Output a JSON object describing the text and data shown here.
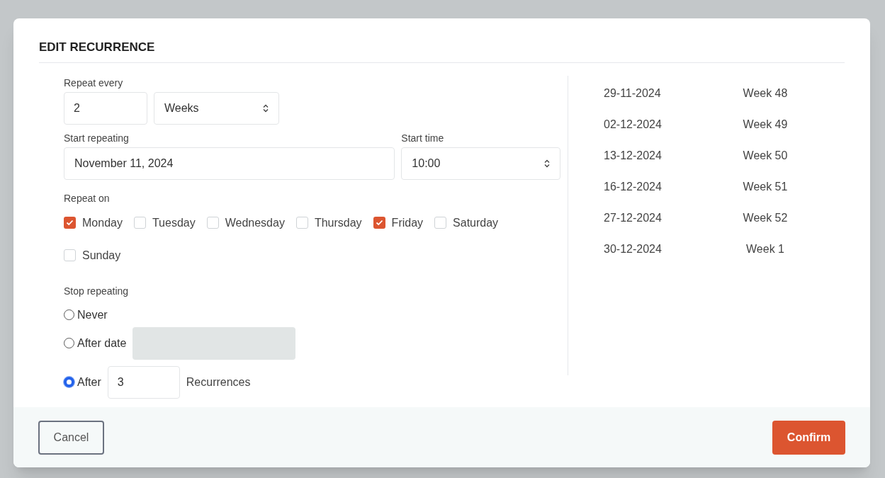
{
  "dialog": {
    "title": "EDIT RECURRENCE"
  },
  "repeat_every": {
    "label": "Repeat every",
    "value": "2",
    "unit": "Weeks"
  },
  "start_repeating": {
    "label": "Start repeating",
    "value": "November 11, 2024"
  },
  "start_time": {
    "label": "Start time",
    "value": "10:00"
  },
  "repeat_on": {
    "label": "Repeat on",
    "days": [
      {
        "label": "Monday",
        "checked": true
      },
      {
        "label": "Tuesday",
        "checked": false
      },
      {
        "label": "Wednesday",
        "checked": false
      },
      {
        "label": "Thursday",
        "checked": false
      },
      {
        "label": "Friday",
        "checked": true
      },
      {
        "label": "Saturday",
        "checked": false
      },
      {
        "label": "Sunday",
        "checked": false
      }
    ]
  },
  "stop_repeating": {
    "label": "Stop repeating",
    "options": [
      {
        "kind": "plain",
        "label": "Never",
        "selected": false
      },
      {
        "kind": "date",
        "label": "After date",
        "selected": false,
        "disabled": true
      },
      {
        "kind": "count",
        "label": "After",
        "selected": true,
        "value": "3",
        "suffix": "Recurrences"
      }
    ]
  },
  "occurrences": [
    {
      "date": "29-11-2024",
      "week": "Week 48"
    },
    {
      "date": "02-12-2024",
      "week": "Week 49"
    },
    {
      "date": "13-12-2024",
      "week": "Week 50"
    },
    {
      "date": "16-12-2024",
      "week": "Week 51"
    },
    {
      "date": "27-12-2024",
      "week": "Week 52"
    },
    {
      "date": "30-12-2024",
      "week": "Week 1"
    }
  ],
  "buttons": {
    "cancel": "Cancel",
    "confirm": "Confirm"
  }
}
